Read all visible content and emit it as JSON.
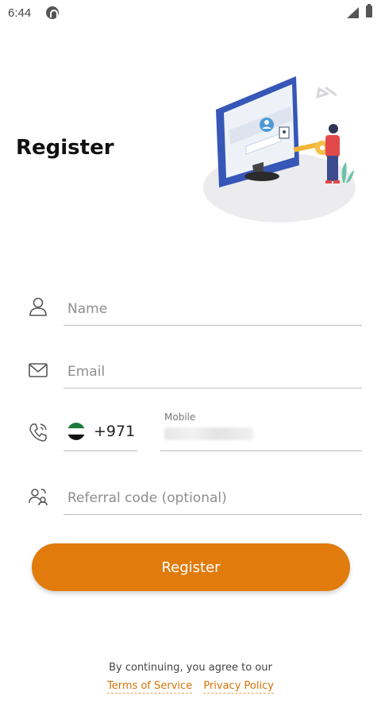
{
  "status_bar": {
    "time": "6:44"
  },
  "header": {
    "title": "Register"
  },
  "form": {
    "name_placeholder": "Name",
    "email_placeholder": "Email",
    "country_code": "+971",
    "mobile_label": "Mobile",
    "referral_placeholder": "Referral code (optional)"
  },
  "actions": {
    "register_label": "Register"
  },
  "footer": {
    "consent_text": "By continuing, you agree to our",
    "terms_label": "Terms of Service",
    "privacy_label": "Privacy Policy"
  },
  "colors": {
    "accent": "#e07b0c",
    "link": "#d77208",
    "underline": "#bdbdbd"
  }
}
